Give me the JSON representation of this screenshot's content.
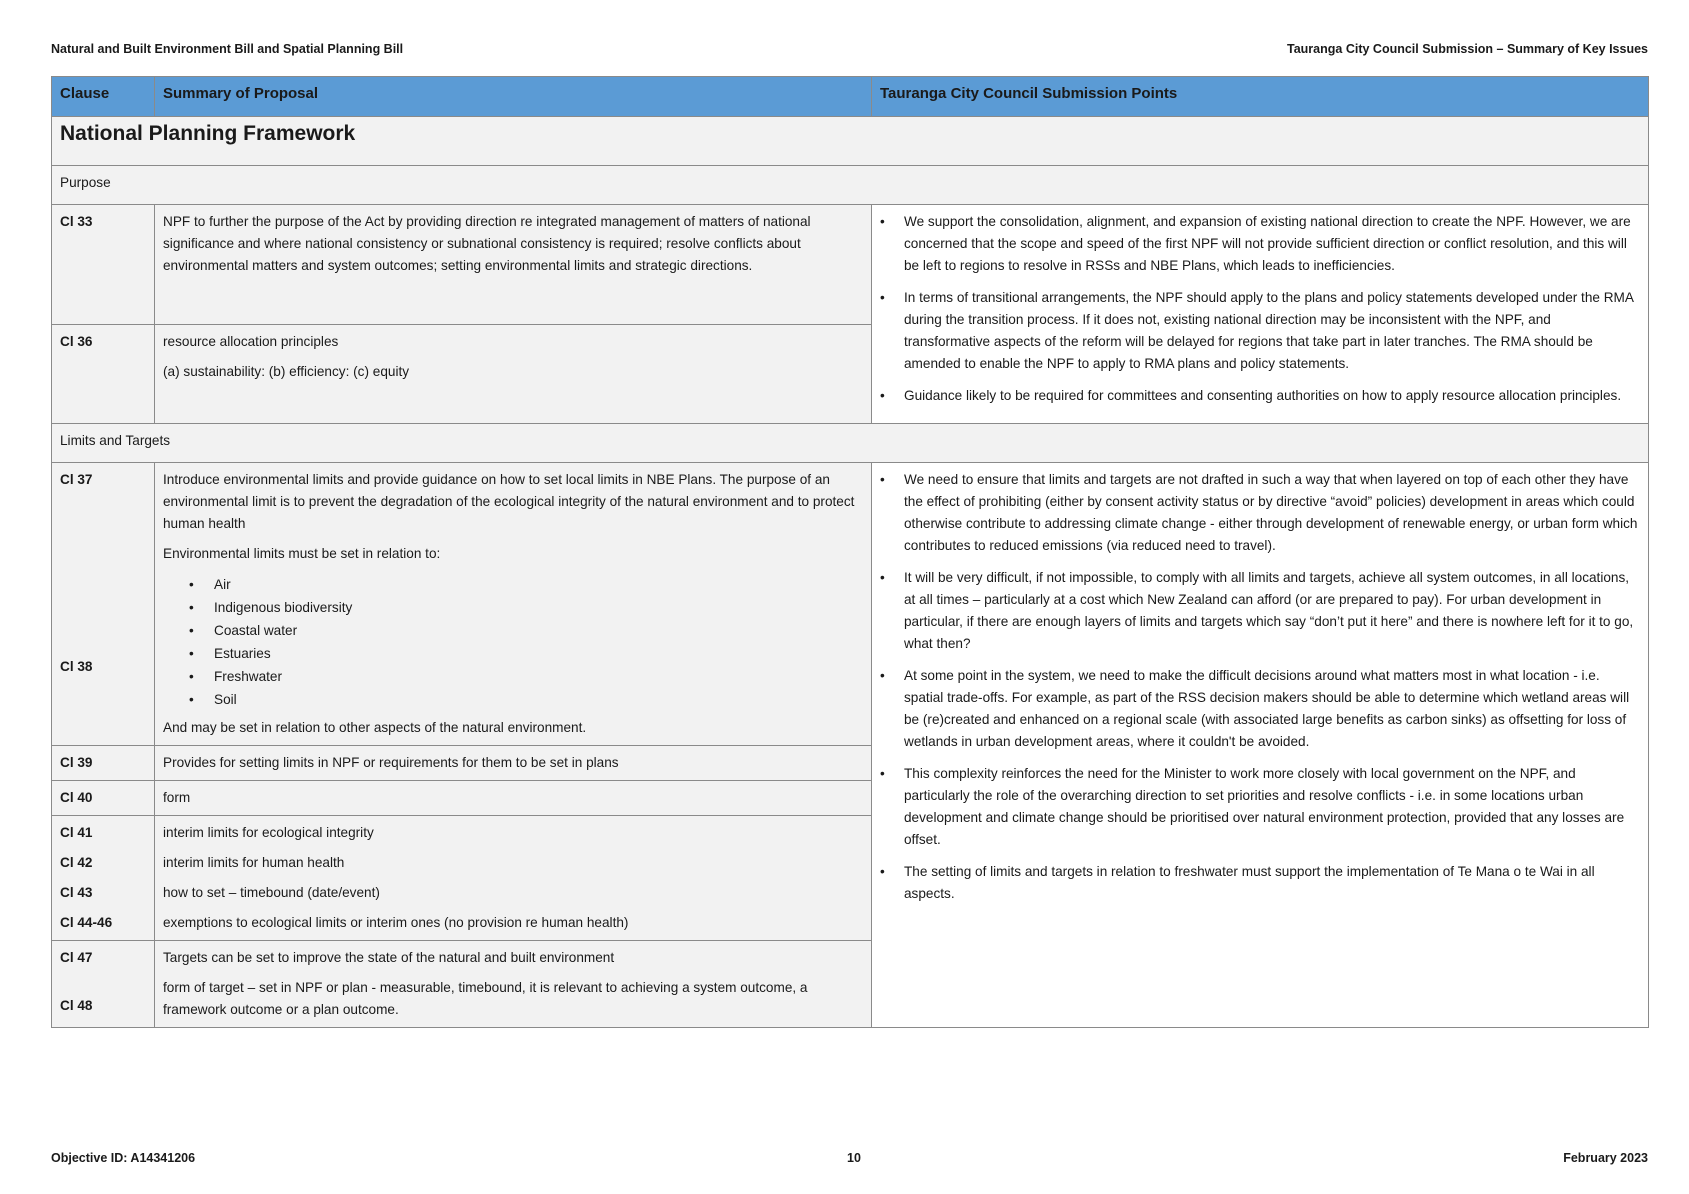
{
  "header": {
    "left": "Natural and Built Environment Bill and Spatial Planning Bill",
    "right": "Tauranga City Council Submission – Summary of Key Issues"
  },
  "table": {
    "columns": [
      "Clause",
      "Summary of Proposal",
      "Tauranga City Council Submission Points"
    ],
    "section_title": "National Planning Framework",
    "groups": {
      "purpose": {
        "title": "Purpose",
        "cl33": {
          "clause": "Cl 33",
          "text": "NPF to further the purpose of the Act by providing direction re integrated management of matters of national significance and where national consistency or subnational consistency is required; resolve conflicts about environmental matters and system outcomes; setting environmental limits and strategic directions."
        },
        "cl36": {
          "clause": "Cl 36",
          "text1": "resource allocation principles",
          "text2": "(a) sustainability: (b) efficiency: (c) equity"
        },
        "points": [
          "We support the consolidation, alignment, and expansion of existing national direction to create the NPF. However, we are concerned that the scope and speed of the first NPF will not provide sufficient direction or conflict resolution, and this will be left to regions to resolve in RSSs and NBE Plans, which leads to inefficiencies.",
          "In terms of transitional arrangements, the NPF should apply to the plans and policy statements developed under the RMA during the transition process.  If it does not, existing national direction may be inconsistent with the NPF, and transformative aspects of the reform will be delayed for regions that take part in later tranches.  The RMA should be amended to enable the NPF to apply to RMA plans and policy statements.",
          "Guidance likely to be required for committees and consenting authorities on how to apply resource allocation principles."
        ]
      },
      "limits": {
        "title": "Limits and Targets",
        "cl37_38": {
          "clause1": "Cl 37",
          "clause2": "Cl 38",
          "text1": "Introduce environmental limits and provide guidance on how to set local limits in NBE Plans. The purpose of an environmental limit is to prevent the degradation of the ecological integrity of the natural environment and to protect human health",
          "text2": "Environmental limits must be set in relation to:",
          "items": [
            "Air",
            "Indigenous biodiversity",
            "Coastal water",
            "Estuaries",
            "Freshwater",
            "Soil"
          ],
          "text3": "And may be set in relation to other aspects of the natural environment."
        },
        "cl39": {
          "clause": "Cl 39",
          "text": "Provides for setting limits in NPF or requirements for them to be set in plans"
        },
        "cl40": {
          "clause": "Cl 40",
          "text": "form"
        },
        "cl41_46": {
          "clauses": [
            "Cl 41",
            "Cl 42",
            "Cl 43",
            "Cl 44-46"
          ],
          "texts": [
            "interim limits for ecological integrity",
            "interim limits for human health",
            "how to set – timebound (date/event)",
            "exemptions to ecological limits or interim ones (no provision re human health)"
          ]
        },
        "cl47_48": {
          "clause1": "Cl 47",
          "clause2": "Cl 48",
          "text1": "Targets can be set to improve the state of the natural and built environment",
          "text2": "form of target – set in NPF or plan - measurable, timebound, it is relevant to achieving a system outcome, a framework outcome or a plan outcome."
        },
        "points": [
          "We need to ensure that limits and targets are not drafted in such a way that when layered on top of each other they have the effect of prohibiting (either by consent activity status or by directive “avoid” policies) development in areas which could otherwise contribute to addressing climate change - either through development of renewable energy, or urban form which contributes to reduced emissions (via reduced need to travel).",
          "It will be very difficult, if not impossible, to comply with all limits and targets, achieve all system outcomes, in all locations, at all times – particularly at a cost which New Zealand can afford (or are prepared to pay).  For urban development in particular, if there are enough layers of limits and targets which say “don’t put it here” and there is nowhere left for it to go, what then?",
          "At some point in the system, we need to make the difficult decisions around what matters most in what location - i.e. spatial trade-offs.  For example, as part of the RSS decision makers should be able to determine which wetland areas will be (re)created and enhanced on a regional scale (with associated large benefits as carbon sinks) as offsetting for loss of wetlands in urban development areas, where it couldn't be avoided.",
          "This complexity reinforces the need for the Minister to work more closely with local government on the NPF, and particularly the role of the overarching direction to set priorities and resolve conflicts - i.e. in some locations urban development and climate change should be prioritised over natural environment protection, provided that any losses are offset.",
          "The setting of limits and targets in relation to freshwater must support the implementation of Te Mana o te Wai in all aspects."
        ]
      }
    }
  },
  "footer": {
    "left": "Objective ID: A14341206",
    "center": "10",
    "right": "February 2023"
  }
}
